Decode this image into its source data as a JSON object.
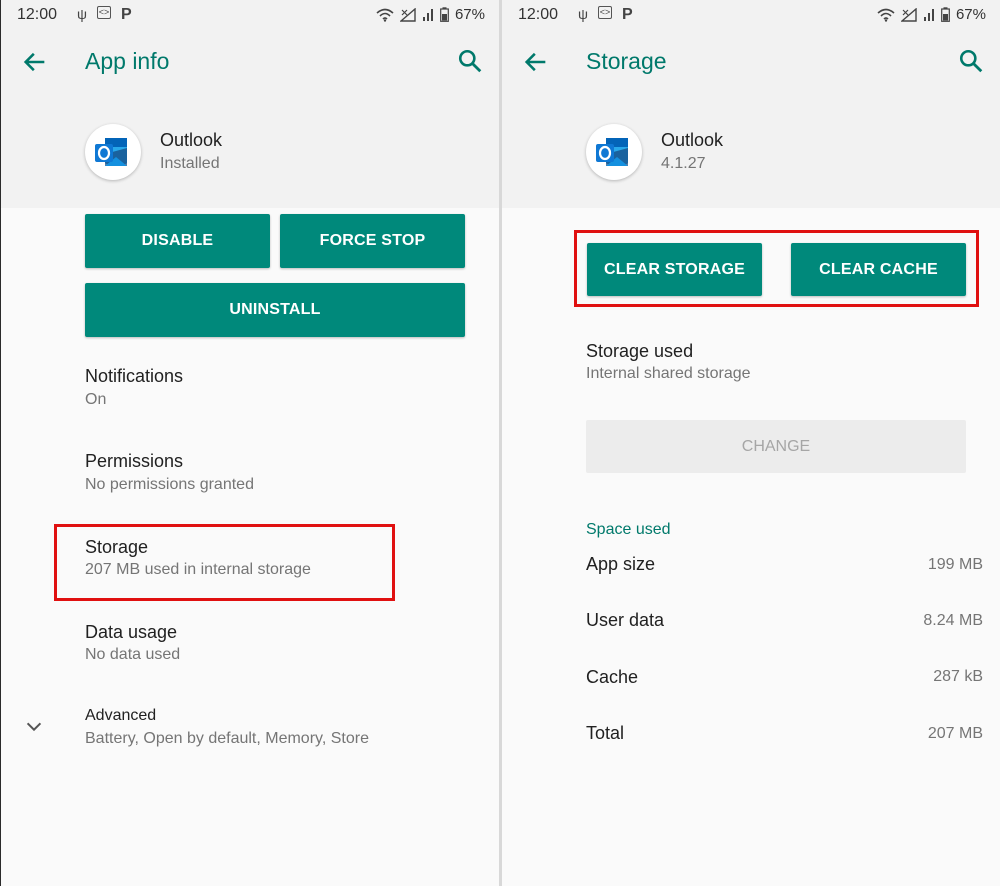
{
  "status_bar": {
    "time": "12:00",
    "battery": "67%",
    "icons": [
      "usb-icon",
      "code-icon",
      "p-icon",
      "wifi-icon",
      "signal-icon",
      "battery-icon"
    ]
  },
  "left": {
    "title": "App info",
    "app_name": "Outlook",
    "app_status": "Installed",
    "buttons": {
      "disable": "DISABLE",
      "force_stop": "FORCE STOP",
      "uninstall": "UNINSTALL"
    },
    "items": [
      {
        "title": "Notifications",
        "subtitle": "On"
      },
      {
        "title": "Permissions",
        "subtitle": "No permissions granted"
      },
      {
        "title": "Storage",
        "subtitle": "207 MB used in internal storage"
      },
      {
        "title": "Data usage",
        "subtitle": "No data used"
      },
      {
        "title": "Advanced",
        "subtitle": "Battery, Open by default, Memory, Store"
      }
    ]
  },
  "right": {
    "title": "Storage",
    "app_name": "Outlook",
    "app_version": "4.1.27",
    "buttons": {
      "clear_storage": "CLEAR STORAGE",
      "clear_cache": "CLEAR CACHE"
    },
    "storage_used": {
      "title": "Storage used",
      "subtitle": "Internal shared storage"
    },
    "change_button": "CHANGE",
    "space_used_label": "Space used",
    "rows": [
      {
        "label": "App size",
        "value": "199 MB"
      },
      {
        "label": "User data",
        "value": "8.24 MB"
      },
      {
        "label": "Cache",
        "value": "287 kB"
      },
      {
        "label": "Total",
        "value": "207 MB"
      }
    ]
  },
  "colors": {
    "accent": "#00796b",
    "button": "#00897b",
    "highlight": "#e01010"
  }
}
